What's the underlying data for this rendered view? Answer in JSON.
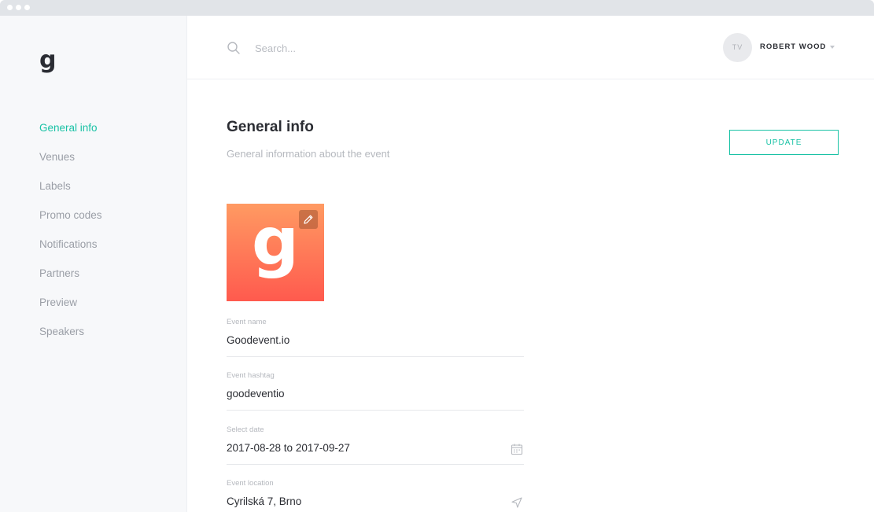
{
  "app": {
    "logo": "g",
    "accent_color": "#19c2a5"
  },
  "sidebar": {
    "items": [
      {
        "label": "General info",
        "active": true
      },
      {
        "label": "Venues",
        "active": false
      },
      {
        "label": "Labels",
        "active": false
      },
      {
        "label": "Promo codes",
        "active": false
      },
      {
        "label": "Notifications",
        "active": false
      },
      {
        "label": "Partners",
        "active": false
      },
      {
        "label": "Preview",
        "active": false
      },
      {
        "label": "Speakers",
        "active": false
      }
    ]
  },
  "header": {
    "search": {
      "placeholder": "Search...",
      "value": "",
      "icon": "search-icon"
    },
    "user": {
      "initials": "TV",
      "name": "ROBERT WOOD",
      "menu_icon": "caret-down-icon"
    }
  },
  "main": {
    "title": "General info",
    "subtitle": "General information about the event",
    "update_label": "UPDATE",
    "event_image": {
      "letter": "g",
      "edit_icon": "pencil-icon"
    },
    "fields": [
      {
        "label": "Event name",
        "value": "Goodevent.io"
      },
      {
        "label": "Event hashtag",
        "value": "goodeventio"
      },
      {
        "label": "Select date",
        "value": "2017-08-28 to 2017-09-27",
        "icon": "calendar-icon"
      },
      {
        "label": "Event location",
        "value": "Cyrilská 7, Brno",
        "icon": "location-arrow-icon"
      }
    ]
  }
}
